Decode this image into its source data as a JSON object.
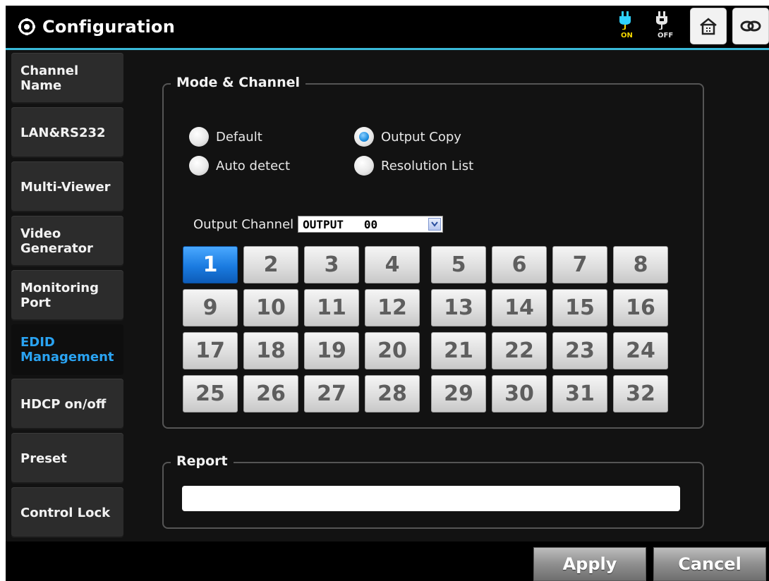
{
  "header": {
    "title": "Configuration",
    "power_on_label": "ON",
    "power_off_label": "OFF",
    "icons": [
      "gear-icon",
      "power-on-icon",
      "power-off-icon",
      "home-icon",
      "link-icon"
    ]
  },
  "sidebar": {
    "items": [
      {
        "label": "Channel\nName",
        "active": false
      },
      {
        "label": "LAN&RS232",
        "active": false
      },
      {
        "label": "Multi-Viewer",
        "active": false
      },
      {
        "label": "Video\nGenerator",
        "active": false
      },
      {
        "label": "Monitoring\nPort",
        "active": false
      },
      {
        "label": "EDID\nManagement",
        "active": true
      },
      {
        "label": "HDCP on/off",
        "active": false
      },
      {
        "label": "Preset",
        "active": false
      },
      {
        "label": "Control Lock",
        "active": false
      }
    ],
    "active_color": "#2aa3f2"
  },
  "mode_channel": {
    "legend": "Mode & Channel",
    "radios": {
      "default": {
        "label": "Default",
        "checked": false
      },
      "auto_detect": {
        "label": "Auto detect",
        "checked": false
      },
      "output_copy": {
        "label": "Output Copy",
        "checked": true
      },
      "resolution_list": {
        "label": "Resolution List",
        "checked": false
      }
    },
    "output_channel_label": "Output Channel",
    "output_channel_value": "OUTPUT   00",
    "channels": [
      "1",
      "2",
      "3",
      "4",
      "5",
      "6",
      "7",
      "8",
      "9",
      "10",
      "11",
      "12",
      "13",
      "14",
      "15",
      "16",
      "17",
      "18",
      "19",
      "20",
      "21",
      "22",
      "23",
      "24",
      "25",
      "26",
      "27",
      "28",
      "29",
      "30",
      "31",
      "32"
    ],
    "selected_channel": "1"
  },
  "report": {
    "legend": "Report",
    "value": ""
  },
  "footer": {
    "apply_label": "Apply",
    "cancel_label": "Cancel"
  },
  "colors": {
    "accent": "#39b9d8",
    "selected_channel": "#1a7be0",
    "power_on": "#f5d800"
  }
}
